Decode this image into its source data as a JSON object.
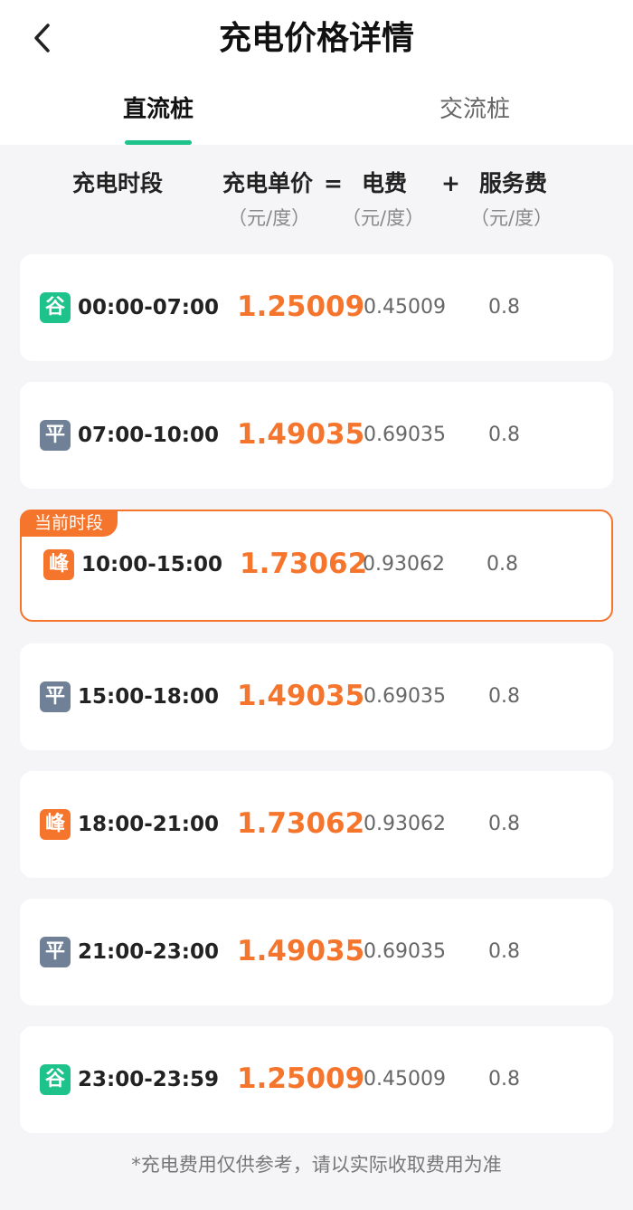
{
  "header": {
    "title": "充电价格详情",
    "tabs": [
      {
        "label": "直流桩",
        "active": true
      },
      {
        "label": "交流桩",
        "active": false
      }
    ]
  },
  "columns": {
    "period": "充电时段",
    "unit_price": "充电单价",
    "equals": "=",
    "electricity": "电费",
    "plus": "+",
    "service": "服务费",
    "unit_price_unit": "（元/度）",
    "electricity_unit": "（元/度）",
    "service_unit": "（元/度）"
  },
  "rows": [
    {
      "type": "valley",
      "badge": "谷",
      "period": "00:00-07:00",
      "unit_price": "1.25009",
      "electricity": "0.45009",
      "service": "0.8"
    },
    {
      "type": "flat",
      "badge": "平",
      "period": "07:00-10:00",
      "unit_price": "1.49035",
      "electricity": "0.69035",
      "service": "0.8"
    },
    {
      "type": "peak",
      "badge": "峰",
      "period": "10:00-15:00",
      "unit_price": "1.73062",
      "electricity": "0.93062",
      "service": "0.8",
      "current": true,
      "current_label": "当前时段"
    },
    {
      "type": "flat",
      "badge": "平",
      "period": "15:00-18:00",
      "unit_price": "1.49035",
      "electricity": "0.69035",
      "service": "0.8"
    },
    {
      "type": "peak",
      "badge": "峰",
      "period": "18:00-21:00",
      "unit_price": "1.73062",
      "electricity": "0.93062",
      "service": "0.8"
    },
    {
      "type": "flat",
      "badge": "平",
      "period": "21:00-23:00",
      "unit_price": "1.49035",
      "electricity": "0.69035",
      "service": "0.8"
    },
    {
      "type": "valley",
      "badge": "谷",
      "period": "23:00-23:59",
      "unit_price": "1.25009",
      "electricity": "0.45009",
      "service": "0.8"
    }
  ],
  "footer": {
    "note": "*充电费用仅供参考，请以实际收取费用为准"
  },
  "colors": {
    "accent_green": "#1ec28b",
    "accent_orange": "#f5752d",
    "flat_gray": "#6f8097"
  },
  "icons": {
    "back": "chevron-left-icon"
  }
}
